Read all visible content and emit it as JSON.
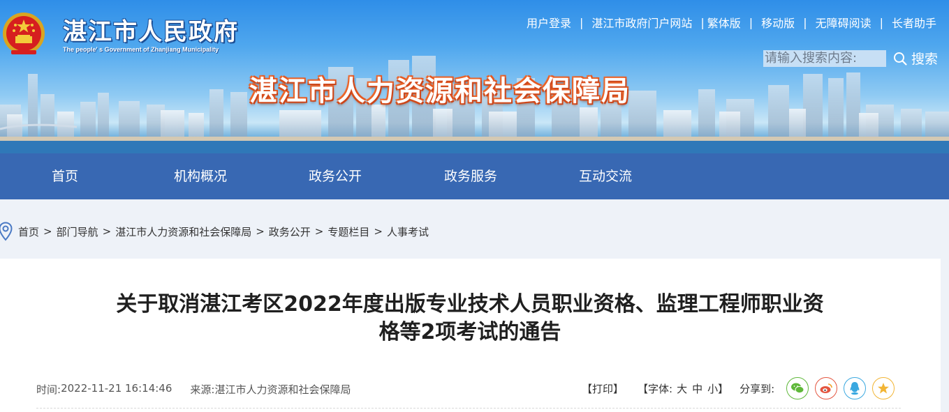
{
  "header": {
    "site_title": "湛江市人民政府",
    "site_subtitle": "The people' s Government of Zhanjiang Municipality",
    "dept_title": "湛江市人力资源和社会保障局",
    "toplinks": [
      "用户登录",
      "湛江市政府门户网站",
      "繁体版",
      "移动版",
      "无障碍阅读",
      "长者助手"
    ],
    "search": {
      "placeholder": "请输入搜索内容:",
      "button_label": "搜索",
      "icon": "search-icon"
    }
  },
  "nav": {
    "items": [
      "首页",
      "机构概况",
      "政务公开",
      "政务服务",
      "互动交流"
    ]
  },
  "breadcrumb": {
    "icon": "location-pin-icon",
    "items": [
      "首页",
      "部门导航",
      "湛江市人力资源和社会保障局",
      "政务公开",
      "专题栏目",
      "人事考试"
    ]
  },
  "article": {
    "title_line1": "关于取消湛江考区2022年度出版专业技术人员职业资格、监理工程师职业资",
    "title_line2": "格等2项考试的通告",
    "time_label": "时间:",
    "time_value": "2022-11-21 16:14:46",
    "source_label": "来源:",
    "source_value": "湛江市人力资源和社会保障局",
    "print_label": "【打印】",
    "font_label_open": "【字体:",
    "font_large": "大",
    "font_medium": "中",
    "font_small": "小",
    "font_label_close": "】",
    "share_label": "分享到:",
    "share_icons": [
      {
        "name": "wechat-icon",
        "color": "#5fb83a"
      },
      {
        "name": "weibo-icon",
        "color": "#e4553f"
      },
      {
        "name": "qq-icon",
        "color": "#3aa8e0"
      },
      {
        "name": "qzone-star-icon",
        "color": "#f2b535"
      }
    ]
  },
  "colors": {
    "nav_bg": "#3868b3",
    "page_bg": "#eef2f8",
    "dept_title_glow": "#e0531f"
  }
}
